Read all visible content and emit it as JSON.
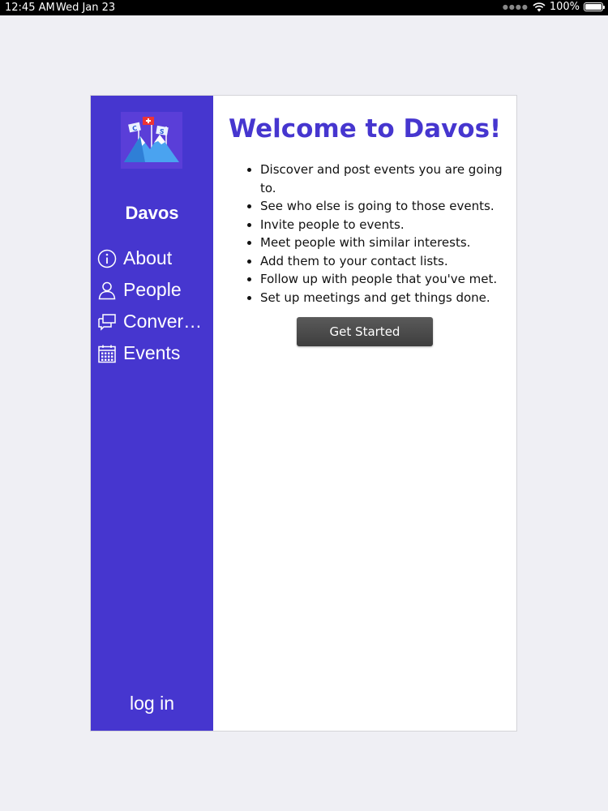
{
  "status_bar": {
    "time": "12:45 AM",
    "date": "Wed Jan 23",
    "battery": "100%"
  },
  "sidebar": {
    "app_name": "Davos",
    "logo_icon": "davos-mountain-flags-logo",
    "items": [
      {
        "label": "About",
        "icon": "info-icon"
      },
      {
        "label": "People",
        "icon": "person-icon"
      },
      {
        "label": "Conversations",
        "icon": "conversations-icon"
      },
      {
        "label": "Events",
        "icon": "calendar-icon"
      }
    ],
    "login_label": "log in"
  },
  "main": {
    "title": "Welcome to Davos!",
    "features": [
      "Discover and post events you are going to.",
      "See who else is going to those events.",
      "Invite people to events.",
      "Meet people with similar interests.",
      "Add them to your contact lists.",
      "Follow up with people that you've met.",
      "Set up meetings and get things done."
    ],
    "get_started_label": "Get Started"
  },
  "colors": {
    "accent": "#4636cf",
    "button": "#4a4a4a",
    "background": "#efeff4"
  }
}
